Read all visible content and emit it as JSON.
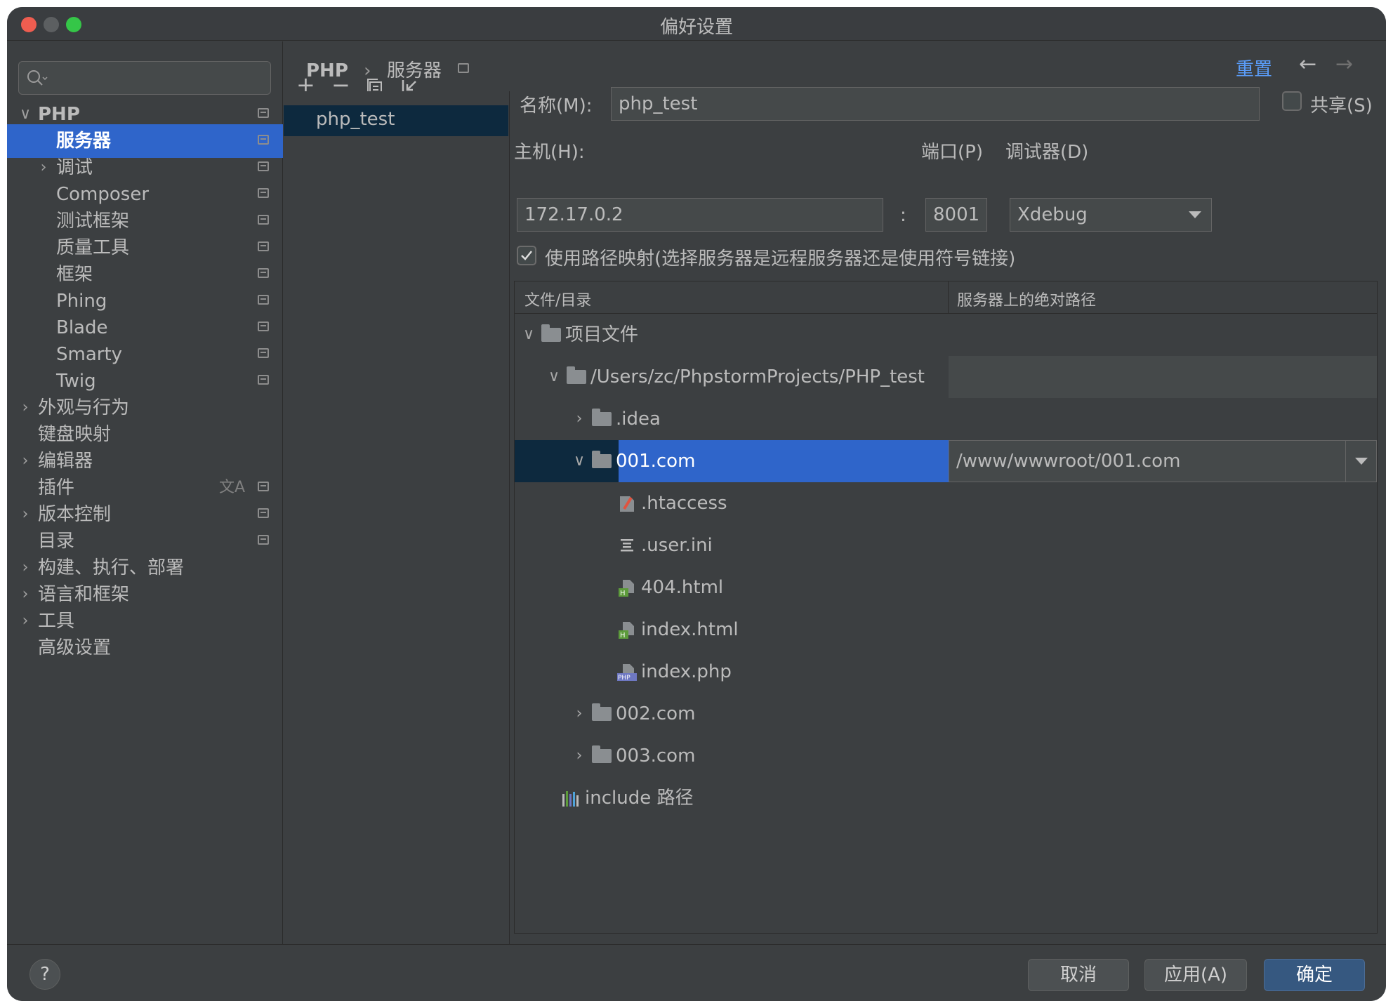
{
  "window": {
    "title": "偏好设置"
  },
  "colors": {
    "accent": "#2f65ca",
    "window_bg": "#3c3f41",
    "close": "#ee5d50",
    "minimize": "#5c5f61",
    "zoom": "#35c648",
    "link": "#5a9cf8"
  },
  "search": {
    "placeholder": ""
  },
  "sidebar": {
    "items": [
      {
        "label": "PHP",
        "chevron": "∨"
      },
      {
        "label": "服务器"
      },
      {
        "label": "调试",
        "chevron": "›"
      },
      {
        "label": "Composer"
      },
      {
        "label": "测试框架"
      },
      {
        "label": "质量工具"
      },
      {
        "label": "框架"
      },
      {
        "label": "Phing"
      },
      {
        "label": "Blade"
      },
      {
        "label": "Smarty"
      },
      {
        "label": "Twig"
      },
      {
        "label": "外观与行为",
        "chevron": "›"
      },
      {
        "label": "键盘映射"
      },
      {
        "label": "编辑器",
        "chevron": "›"
      },
      {
        "label": "插件"
      },
      {
        "label": "版本控制",
        "chevron": "›"
      },
      {
        "label": "目录"
      },
      {
        "label": "构建、执行、部署",
        "chevron": "›"
      },
      {
        "label": "语言和框架",
        "chevron": "›"
      },
      {
        "label": "工具",
        "chevron": "›"
      },
      {
        "label": "高级设置"
      }
    ]
  },
  "breadcrumb": {
    "root": "PHP",
    "separator": "›",
    "current": "服务器"
  },
  "header": {
    "reset_label": "重置",
    "back_arrow": "←",
    "forward_arrow": "→"
  },
  "servers": {
    "toolbar": {
      "add": "+",
      "remove": "−"
    },
    "list": [
      "php_test"
    ]
  },
  "form": {
    "name_label": "名称(M):",
    "name_value": "php_test",
    "shared_label": "共享(S)",
    "host_label": "主机(H):",
    "host_value": "172.17.0.2",
    "port_label": "端口(P)",
    "port_value": "8001",
    "colon": ":",
    "debugger_label": "调试器(D)",
    "debugger_value": "Xdebug",
    "use_mappings_label": "使用路径映射(选择服务器是远程服务器还是使用符号链接)",
    "use_mappings_checked": true
  },
  "mapping_table": {
    "columns": [
      "文件/目录",
      "服务器上的绝对路径"
    ],
    "rows": [
      {
        "name": "项目文件",
        "icon": "folder-icon",
        "expanded": true
      },
      {
        "name": "/Users/zc/PhpstormProjects/PHP_test",
        "icon": "folder-icon",
        "expanded": true
      },
      {
        "name": ".idea",
        "icon": "folder-icon",
        "expanded": false
      },
      {
        "name": "001.com",
        "icon": "folder-icon",
        "expanded": true,
        "selected": true,
        "server_path": "/www/wwwroot/001.com"
      },
      {
        "name": ".htaccess",
        "icon": "htaccess-file-icon"
      },
      {
        "name": ".user.ini",
        "icon": "ini-file-icon"
      },
      {
        "name": "404.html",
        "icon": "html-file-icon"
      },
      {
        "name": "index.html",
        "icon": "html-file-icon"
      },
      {
        "name": "index.php",
        "icon": "php-file-icon"
      },
      {
        "name": "002.com",
        "icon": "folder-icon",
        "expanded": false
      },
      {
        "name": "003.com",
        "icon": "folder-icon",
        "expanded": false
      },
      {
        "name": "include 路径",
        "icon": "library-icon"
      }
    ]
  },
  "footer": {
    "help": "?",
    "cancel": "取消",
    "apply": "应用(A)",
    "ok": "确定"
  }
}
